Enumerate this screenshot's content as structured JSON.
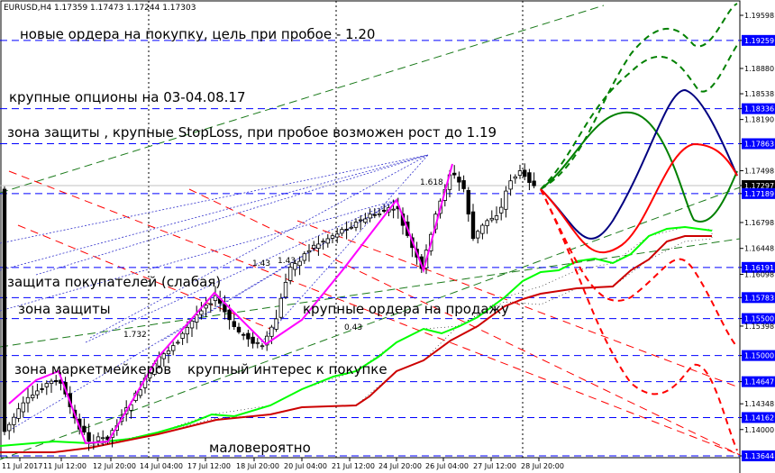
{
  "chart_data": {
    "type": "candlestick",
    "header": "EURUSD,H4  1.17359 1.17473 1.17244 1.17303",
    "current_price": "1.17297",
    "y_ticks": [
      "1.19598",
      "1.19259",
      "1.18880",
      "1.18538",
      "1.18336",
      "1.18190",
      "1.17863",
      "1.17498",
      "1.17297",
      "1.17189",
      "1.16798",
      "1.16448",
      "1.16191",
      "1.16098",
      "1.15783",
      "1.15500",
      "1.15398",
      "1.15000",
      "1.14647",
      "1.14348",
      "1.14162",
      "1.14000",
      "1.13644"
    ],
    "x_ticks": [
      "11 Jul 2017",
      "11 Jul 12:00",
      "12 Jul 20:00",
      "14 Jul 04:00",
      "17 Jul 12:00",
      "18 Jul 20:00",
      "20 Jul 04:00",
      "21 Jul 12:00",
      "24 Jul 20:00",
      "26 Jul 04:00",
      "27 Jul 12:00",
      "28 Jul 20:00"
    ],
    "levels": [
      {
        "price": "1.19259",
        "style": "dash",
        "color": "#0000ff"
      },
      {
        "price": "1.18336",
        "style": "dash",
        "color": "#0000ff"
      },
      {
        "price": "1.17863",
        "style": "dash",
        "color": "#0000ff"
      },
      {
        "price": "1.17189",
        "style": "dash",
        "color": "#0000ff"
      },
      {
        "price": "1.16191",
        "style": "dash",
        "color": "#0000ff"
      },
      {
        "price": "1.15783",
        "style": "dash",
        "color": "#0000ff"
      },
      {
        "price": "1.15500",
        "style": "dash",
        "color": "#0000ff"
      },
      {
        "price": "1.15000",
        "style": "dash",
        "color": "#0000ff"
      },
      {
        "price": "1.14647",
        "style": "dash",
        "color": "#0000ff"
      },
      {
        "price": "1.14162",
        "style": "dash",
        "color": "#0000ff"
      },
      {
        "price": "1.13644",
        "style": "dash",
        "color": "#0000ff"
      }
    ],
    "fib_labels": [
      "1.618",
      "1.43",
      "1.43",
      "0.43",
      "1.732"
    ],
    "annotations": [
      "новые ордера на покупку, цель при пробое - 1.20",
      "крупные опционы на 03-04.08.17",
      "зона защиты , крупные StopLoss, при пробое возможен рост до 1.19",
      "защита покупателей (слабая)",
      "зона защиты",
      "крупные ордера на продажу",
      "зона маркетмейкеров",
      "крупный интерес к покупке",
      "маловероятно"
    ],
    "colors": {
      "bull": "#000000",
      "bear": "#000000",
      "zigzag": "#ff00ff",
      "ichimoku_fast": "#00ff00",
      "ichimoku_slow": "#cc0000",
      "levels": "#0000ff",
      "forecast_up": "#008000",
      "forecast_down": "#ff0000",
      "forecast_mid": "#000080"
    }
  }
}
